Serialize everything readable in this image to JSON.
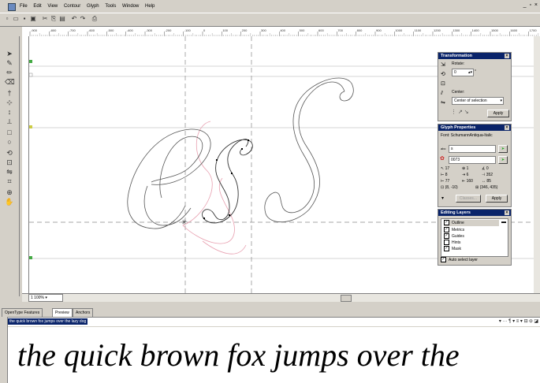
{
  "menu": {
    "items": [
      "File",
      "Edit",
      "View",
      "Contour",
      "Glyph",
      "Tools",
      "Window",
      "Help"
    ],
    "window_controls": "_ ▫ ×"
  },
  "ruler": {
    "ticks": [
      "-900",
      "-800",
      "-700",
      "-600",
      "-500",
      "-400",
      "-300",
      "-200",
      "-100",
      "0",
      "100",
      "200",
      "300",
      "400",
      "500",
      "600",
      "700",
      "800",
      "900",
      "1000",
      "1100",
      "1200",
      "1300",
      "1400",
      "1500",
      "1600",
      "1700"
    ]
  },
  "canvas": {
    "glyphs": "esS",
    "status_zoom": "100%",
    "layer_index": "1"
  },
  "transformation": {
    "title": "Transformation",
    "rotate_label": "Rotate:",
    "rotate_value": "0",
    "degree": "°",
    "center_label": "Center:",
    "center_value": "Center of selection",
    "apply": "Apply"
  },
  "glyph_properties": {
    "title": "Glyph Properties",
    "font_line": "Font: SchumannAntiqua-Italic",
    "name_value": "s",
    "unicode_value": "0073",
    "metrics": {
      "x": "17",
      "y": "1",
      "a": "0",
      "lsb": "8",
      "adv": "6",
      "width": "352",
      "rsb": "77",
      "w2": "160",
      "h": "85",
      "origin": "(8, -10)",
      "size": "(346, 435)"
    },
    "classes": "Classes...",
    "apply": "Apply"
  },
  "editing_layers": {
    "title": "Editing Layers",
    "layers": [
      {
        "label": "Outline",
        "checked": true
      },
      {
        "label": "Metrics",
        "checked": true
      },
      {
        "label": "Guides",
        "checked": true
      },
      {
        "label": "Hints",
        "checked": false
      },
      {
        "label": "Mask",
        "checked": true
      }
    ],
    "auto_select": "Auto select layer"
  },
  "bottom": {
    "tabs": [
      "OpenType Features",
      "Preview",
      "Anchors"
    ],
    "active_tab": "Preview",
    "preview_input": "the quick brown fox jumps over the lazy dog",
    "preview_text": "the quick brown fox jumps over the",
    "preview_controls": "▾ ··· ¶ ▾ ≡ ▾ ⊟ ⦶ ◪"
  },
  "colors": {
    "titlebar": "#0a246a",
    "chrome": "#d4d0c8",
    "mask_outline": "#e8a0b0"
  }
}
